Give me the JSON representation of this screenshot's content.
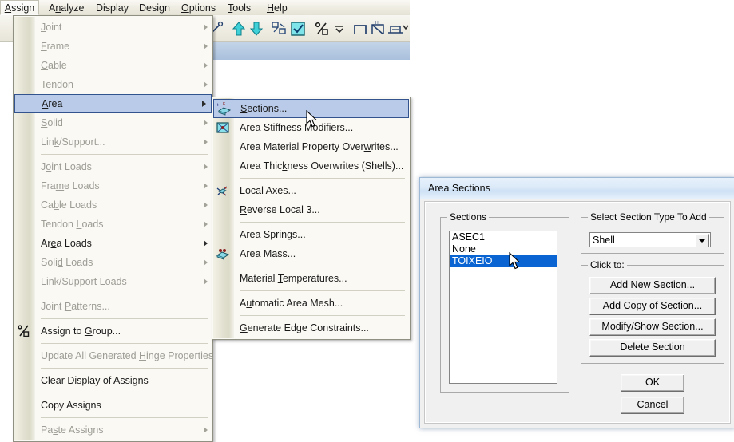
{
  "menubar": {
    "items": [
      {
        "label": "Assign",
        "acc": "A",
        "active": true
      },
      {
        "label": "Analyze",
        "acc": "n",
        "active": false
      },
      {
        "label": "Display",
        "acc": "",
        "active": false
      },
      {
        "label": "Design",
        "acc": "g",
        "active": false
      },
      {
        "label": "Options",
        "acc": "O",
        "active": false
      },
      {
        "label": "Tools",
        "acc": "T",
        "active": false
      },
      {
        "label": "Help",
        "acc": "H",
        "active": false
      }
    ]
  },
  "assign_menu": {
    "items": [
      {
        "label": "Joint",
        "acc": "J",
        "disabled": true,
        "submenu": true,
        "sep_after": false
      },
      {
        "label": "Frame",
        "acc": "F",
        "disabled": true,
        "submenu": true,
        "sep_after": false
      },
      {
        "label": "Cable",
        "acc": "C",
        "disabled": true,
        "submenu": true,
        "sep_after": false
      },
      {
        "label": "Tendon",
        "acc": "T",
        "disabled": true,
        "submenu": true,
        "sep_after": false
      },
      {
        "label": "Area",
        "acc": "A",
        "disabled": false,
        "submenu": true,
        "selected": true,
        "sep_after": false
      },
      {
        "label": "Solid",
        "acc": "S",
        "disabled": true,
        "submenu": true,
        "sep_after": false
      },
      {
        "label": "Link/Support...",
        "acc": "k",
        "disabled": true,
        "submenu": true,
        "sep_after": true
      },
      {
        "label": "Joint Loads",
        "acc": "o",
        "disabled": true,
        "submenu": true,
        "sep_after": false
      },
      {
        "label": "Frame Loads",
        "acc": "m",
        "disabled": true,
        "submenu": true,
        "sep_after": false
      },
      {
        "label": "Cable Loads",
        "acc": "b",
        "disabled": true,
        "submenu": true,
        "sep_after": false
      },
      {
        "label": "Tendon Loads",
        "acc": "L",
        "disabled": true,
        "submenu": true,
        "sep_after": false
      },
      {
        "label": "Area Loads",
        "acc": "e",
        "disabled": false,
        "submenu": true,
        "sep_after": false
      },
      {
        "label": "Solid Loads",
        "acc": "d",
        "disabled": true,
        "submenu": true,
        "sep_after": false
      },
      {
        "label": "Link/Support Loads",
        "acc": "u",
        "disabled": true,
        "submenu": true,
        "sep_after": true
      },
      {
        "label": "Joint Patterns...",
        "acc": "P",
        "disabled": true,
        "submenu": false,
        "sep_after": true
      },
      {
        "label": "Assign to Group...",
        "acc": "G",
        "disabled": false,
        "submenu": false,
        "icon": "assign-to-group-icon",
        "sep_after": true
      },
      {
        "label": "Update All Generated Hinge Properties",
        "acc": "H",
        "disabled": true,
        "submenu": false,
        "sep_after": true
      },
      {
        "label": "Clear Display of Assigns",
        "acc": "y",
        "disabled": false,
        "submenu": false,
        "sep_after": true
      },
      {
        "label": "Copy Assigns",
        "acc": "g",
        "disabled": false,
        "submenu": false,
        "sep_after": true
      },
      {
        "label": "Paste Assigns",
        "acc": "s",
        "disabled": true,
        "submenu": true,
        "sep_after": false
      }
    ]
  },
  "area_submenu": {
    "items": [
      {
        "label": "Sections...",
        "acc": "S",
        "selected": true,
        "icon": "area-sections-icon",
        "sep_after": false
      },
      {
        "label": "Area Stiffness Modifiers...",
        "acc": "d",
        "icon": "area-stiffness-icon",
        "sep_after": false
      },
      {
        "label": "Area Material Property Overwrites...",
        "acc": "w",
        "icon": "",
        "sep_after": false
      },
      {
        "label": "Area Thickness Overwrites (Shells)...",
        "acc": "k",
        "icon": "",
        "sep_after": true
      },
      {
        "label": "Local Axes...",
        "acc": "A",
        "icon": "local-axes-icon",
        "sep_after": false
      },
      {
        "label": "Reverse Local 3...",
        "acc": "R",
        "icon": "",
        "sep_after": true
      },
      {
        "label": "Area Springs...",
        "acc": "p",
        "icon": "",
        "sep_after": false
      },
      {
        "label": "Area Mass...",
        "acc": "M",
        "icon": "area-mass-icon",
        "sep_after": true
      },
      {
        "label": "Material Temperatures...",
        "acc": "T",
        "icon": "",
        "sep_after": true
      },
      {
        "label": "Automatic Area Mesh...",
        "acc": "u",
        "icon": "",
        "sep_after": true
      },
      {
        "label": "Generate Edge Constraints...",
        "acc": "G",
        "icon": "",
        "sep_after": false
      }
    ]
  },
  "dialog": {
    "title": "Area Sections",
    "sections_group_label": "Sections",
    "sections_list": [
      {
        "label": "ASEC1",
        "selected": false
      },
      {
        "label": "None",
        "selected": false
      },
      {
        "label": "TOIXEIO",
        "selected": true
      }
    ],
    "type_group_label": "Select Section Type To Add",
    "type_value": "Shell",
    "click_group_label": "Click to:",
    "buttons": [
      {
        "label": "Add New Section..."
      },
      {
        "label": "Add Copy of Section..."
      },
      {
        "label": "Modify/Show Section..."
      },
      {
        "label": "Delete Section"
      }
    ],
    "ok_label": "OK",
    "cancel_label": "Cancel"
  },
  "colors": {
    "menu_highlight": "#b9cbe8",
    "menu_highlight_border": "#33538e",
    "list_selection": "#0a64d2",
    "menu_bg": "#faf9f4",
    "dialog_bg": "#f0f0f0"
  }
}
